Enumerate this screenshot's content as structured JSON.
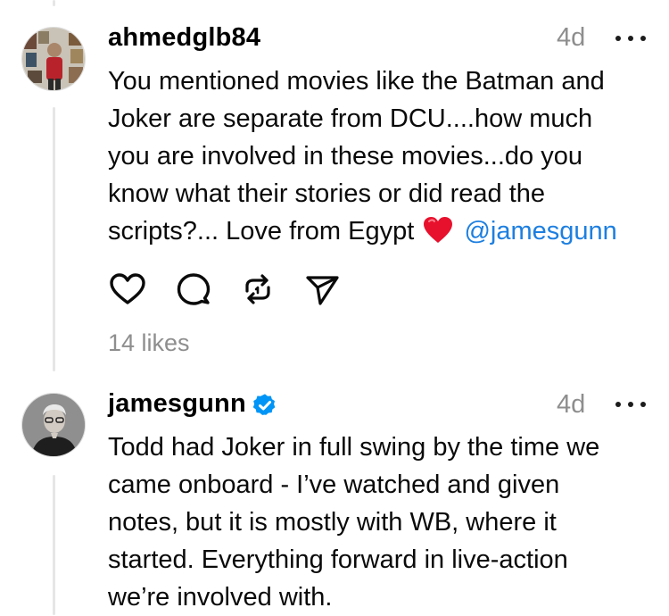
{
  "comments": [
    {
      "username": "ahmedglb84",
      "time": "4d",
      "text_lines": [
        "You mentioned movies like the Batman and",
        "Joker are separate from DCU....how much",
        "you are involved in these movies...do you",
        "know what their stories or did read the",
        "scripts?... Love from Egypt"
      ],
      "emoji": "red-heart",
      "mention": "@jamesgunn",
      "likes": "14 likes",
      "actions": [
        "like-icon",
        "comment-icon",
        "repost-icon",
        "share-icon"
      ]
    },
    {
      "username": "jamesgunn",
      "verified": true,
      "time": "4d",
      "text_lines": [
        "Todd had Joker in full swing by the time we",
        "came onboard - I’ve watched and given",
        "notes, but it is mostly with WB, where it",
        "started. Everything forward in live-action",
        "we’re involved with."
      ]
    }
  ],
  "colors": {
    "mention": "#1d7fe0",
    "verified": "#0095f6",
    "muted": "#8e8e8e",
    "heart": "#e8112d"
  }
}
